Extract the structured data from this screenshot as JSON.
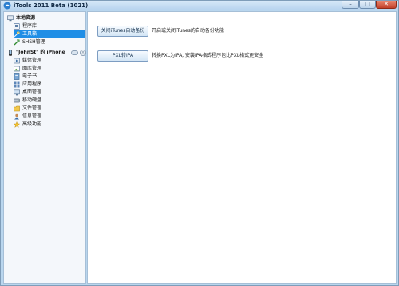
{
  "window": {
    "title": "iTools 2011 Beta (1021)",
    "controls": {
      "minimize": "–",
      "maximize": "□",
      "close": "✕"
    }
  },
  "sidebar": {
    "local_group": {
      "label": "本地资源",
      "items": [
        {
          "label": "程序库",
          "icon": "app-library-icon"
        },
        {
          "label": "工具箱",
          "icon": "toolbox-icon",
          "selected": true
        },
        {
          "label": "SHSH管理",
          "icon": "shsh-icon"
        }
      ]
    },
    "device_group": {
      "label": "\"JohnSt\" 的 iPhone",
      "eject_glyph": "×",
      "items": [
        {
          "label": "媒体管理",
          "icon": "media-icon"
        },
        {
          "label": "图库管理",
          "icon": "photo-icon"
        },
        {
          "label": "电子书",
          "icon": "ebook-icon"
        },
        {
          "label": "应用程序",
          "icon": "apps-icon"
        },
        {
          "label": "桌面管理",
          "icon": "desktop-icon"
        },
        {
          "label": "移动硬盘",
          "icon": "disk-icon"
        },
        {
          "label": "文件管理",
          "icon": "file-icon"
        },
        {
          "label": "信息管理",
          "icon": "contacts-icon"
        },
        {
          "label": "高级功能",
          "icon": "star-icon"
        }
      ]
    }
  },
  "tools": [
    {
      "button_label": "关闭iTunes自动备份",
      "description": "开启或关闭iTunes的自动备份功能"
    },
    {
      "button_label": "PXL转IPA",
      "description": "转换PXL为IPA, 安装IPA格式程序包比PXL格式更安全"
    }
  ],
  "colors": {
    "selection": "#1f8ee6",
    "frame": "#b9d6ee",
    "accent_close": "#c2402a"
  }
}
